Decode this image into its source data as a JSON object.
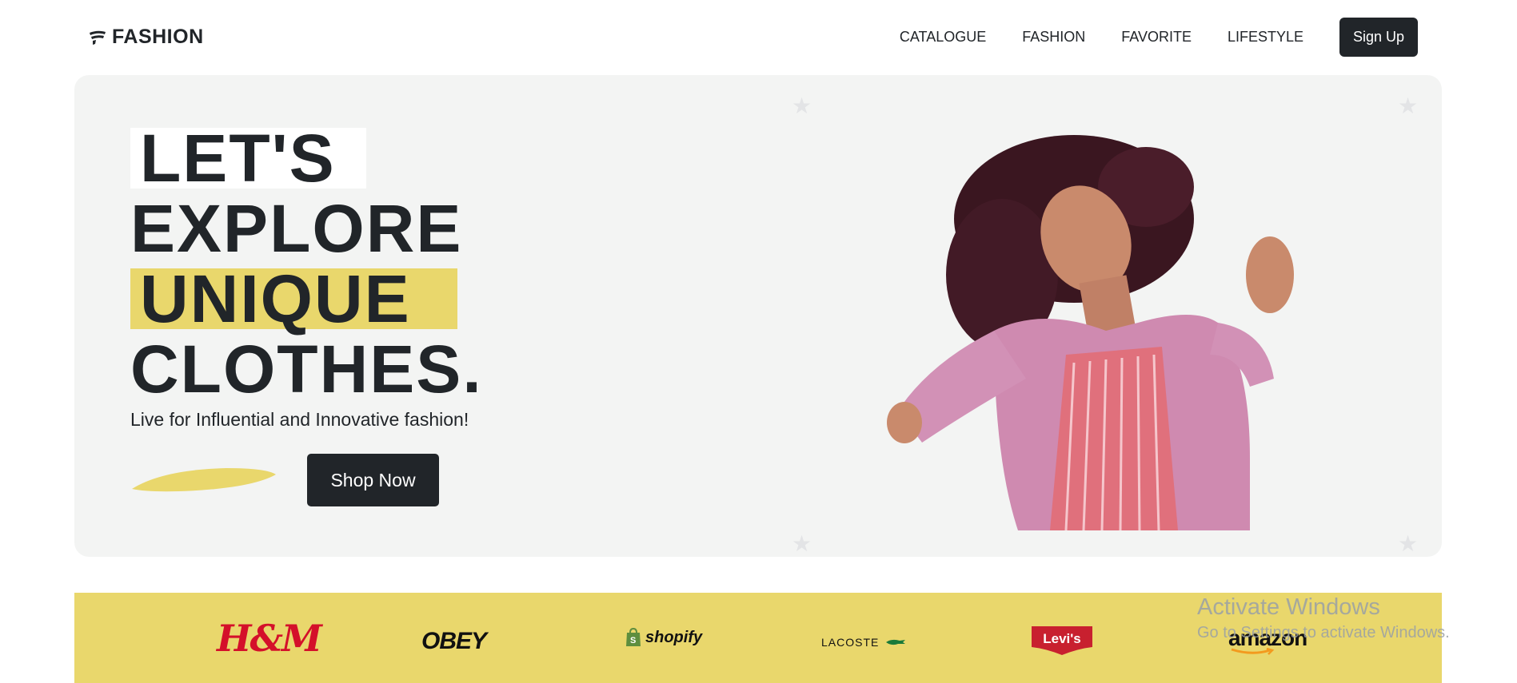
{
  "header": {
    "logo_text": "FASHION",
    "nav": [
      "CATALOGUE",
      "FASHION",
      "FAVORITE",
      "LIFESTYLE"
    ],
    "signup_label": "Sign Up"
  },
  "hero": {
    "headline": [
      "LET'S",
      "EXPLORE",
      "UNIQUE",
      "CLOTHES."
    ],
    "subtitle": "Live for Influential and Innovative fashion!",
    "cta_label": "Shop Now",
    "image_alt": "woman in pink fluffy coat dancing"
  },
  "brands": {
    "hm": "H&M",
    "obey": "OBEY",
    "shopify": "shopify",
    "lacoste": "LACOSTE",
    "levis": "Levi's",
    "amazon": "amazon"
  },
  "watermark": {
    "title": "Activate Windows",
    "subtitle": "Go to Settings to activate Windows."
  },
  "colors": {
    "dark": "#212529",
    "accent_yellow": "#e9d76c",
    "hero_bg": "#f3f4f3",
    "hm_red": "#d4102a",
    "levis_red": "#c8202f"
  }
}
